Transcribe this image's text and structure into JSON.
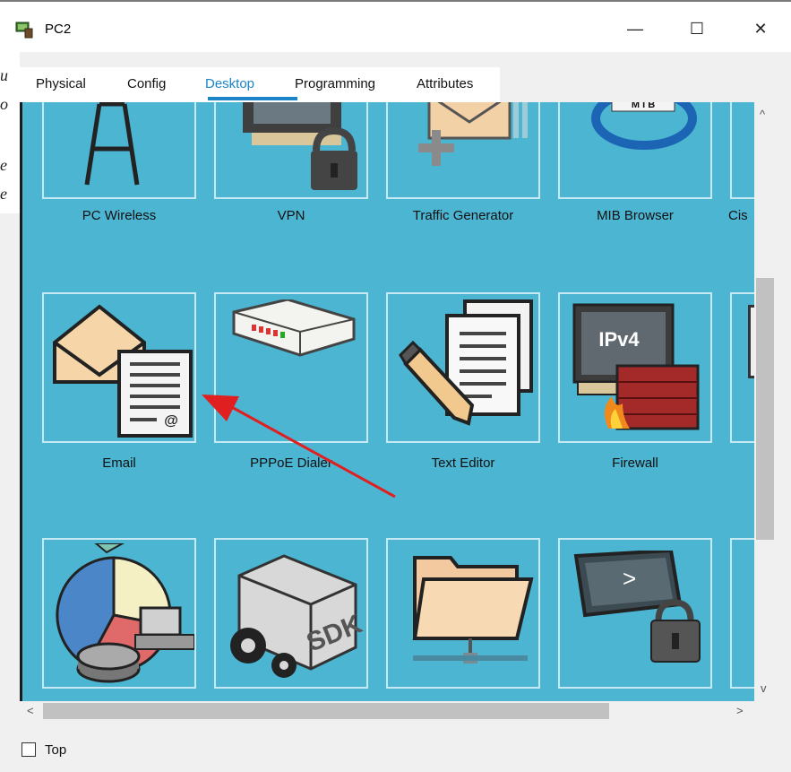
{
  "window": {
    "title": "PC2",
    "controls": {
      "minimize": "—",
      "maximize": "☐",
      "close": "✕"
    }
  },
  "tabs": [
    {
      "label": "Physical"
    },
    {
      "label": "Config"
    },
    {
      "label": "Desktop"
    },
    {
      "label": "Programming"
    },
    {
      "label": "Attributes"
    }
  ],
  "active_tab": "Desktop",
  "apps": {
    "row1": [
      {
        "label": "PC Wireless",
        "icon": "pc-wireless-icon"
      },
      {
        "label": "VPN",
        "icon": "vpn-icon"
      },
      {
        "label": "Traffic Generator",
        "icon": "traffic-generator-icon"
      },
      {
        "label": "MIB Browser",
        "icon": "mib-browser-icon"
      },
      {
        "label": "Cis",
        "icon": "partial-icon"
      }
    ],
    "row2": [
      {
        "label": "Email",
        "icon": "email-icon"
      },
      {
        "label": "PPPoE Dialer",
        "icon": "pppoe-dialer-icon"
      },
      {
        "label": "Text Editor",
        "icon": "text-editor-icon"
      },
      {
        "label": "Firewall",
        "icon": "firewall-icon"
      }
    ],
    "row3_icons": [
      "network-stats-icon",
      "sdk-icon",
      "file-manager-icon",
      "terminal-lock-icon"
    ]
  },
  "icon_text": {
    "mib": "M I B",
    "ipv4": "IPv4",
    "sdk": "SDK",
    "prompt": ">",
    "at": "@"
  },
  "scroll": {
    "up": "^",
    "down": "v",
    "left": "<",
    "right": ">"
  },
  "bottom": {
    "top_checkbox_label": "Top",
    "top_checked": false
  },
  "side_text": [
    "u",
    "o",
    "e",
    "e"
  ],
  "colors": {
    "desktop_bg": "#4cb5d2",
    "tab_active": "#1c85c7",
    "annotation_arrow": "#e02020"
  }
}
